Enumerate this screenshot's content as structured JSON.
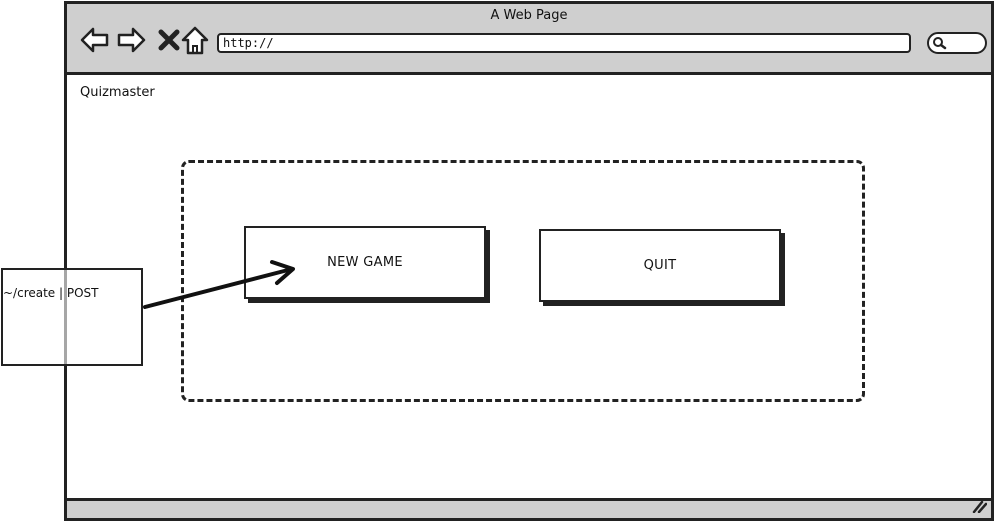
{
  "window": {
    "title": "A Web Page",
    "address": "http://"
  },
  "app": {
    "name": "Quizmaster"
  },
  "menu": {
    "new_game_label": "NEW GAME",
    "quit_label": "QUIT"
  },
  "annotation": {
    "note_text": "~/create | POST"
  },
  "icons": {
    "back": "back-arrow-icon",
    "forward": "forward-arrow-icon",
    "stop": "close-icon",
    "home": "home-icon",
    "search": "search-icon",
    "resize": "resize-grip-icon"
  },
  "colors": {
    "chrome": "#cfcfcf",
    "ink": "#222222",
    "background": "#ffffff"
  }
}
